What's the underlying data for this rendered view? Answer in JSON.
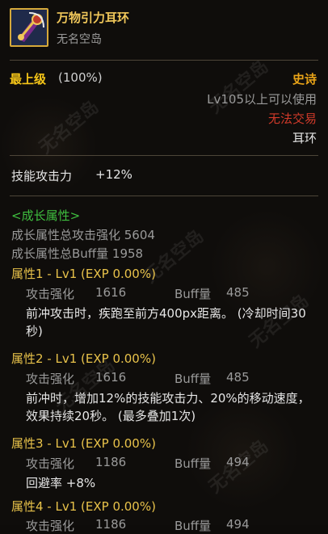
{
  "item": {
    "name": "万物引力耳环",
    "subtitle": "无名空岛",
    "grade_name": "最上级",
    "grade_percent": "(100%)",
    "rarity": "史诗",
    "level_req": "Lv105以上可以使用",
    "trade": "无法交易",
    "slot": "耳环"
  },
  "skill_attack": {
    "label": "技能攻击力",
    "value": "+12%"
  },
  "growth": {
    "header": "<成长属性>",
    "total_attack": "成长属性总攻击强化 5604",
    "total_buff": "成长属性总Buff量 1958",
    "attrs": [
      {
        "head": "属性1 - Lv1 (EXP 0.00%)",
        "atk_label": "攻击强化",
        "atk_value": "1616",
        "buff_label": "Buff量",
        "buff_value": "485",
        "desc": "前冲攻击时，疾跑至前方400px距离。 (冷却时间30秒)"
      },
      {
        "head": "属性2 - Lv1 (EXP 0.00%)",
        "atk_label": "攻击强化",
        "atk_value": "1616",
        "buff_label": "Buff量",
        "buff_value": "485",
        "desc": "前冲时，增加12%的技能攻击力、20%的移动速度，效果持续20秒。 (最多叠加1次)"
      },
      {
        "head": "属性3 - Lv1 (EXP 0.00%)",
        "atk_label": "攻击强化",
        "atk_value": "1186",
        "buff_label": "Buff量",
        "buff_value": "494",
        "desc": "回避率 +8%"
      },
      {
        "head": "属性4 - Lv1 (EXP 0.00%)",
        "atk_label": "攻击强化",
        "atk_value": "1186",
        "buff_label": "Buff量",
        "buff_value": "494"
      }
    ]
  },
  "colors": {
    "title": "#f0c75a",
    "grade": "#f5c518",
    "rarity": "#e8a318",
    "untradeable": "#d23a2a",
    "growth_header": "#3fbf3f",
    "attr_head": "#e8c24a"
  },
  "watermark": "无名空岛"
}
